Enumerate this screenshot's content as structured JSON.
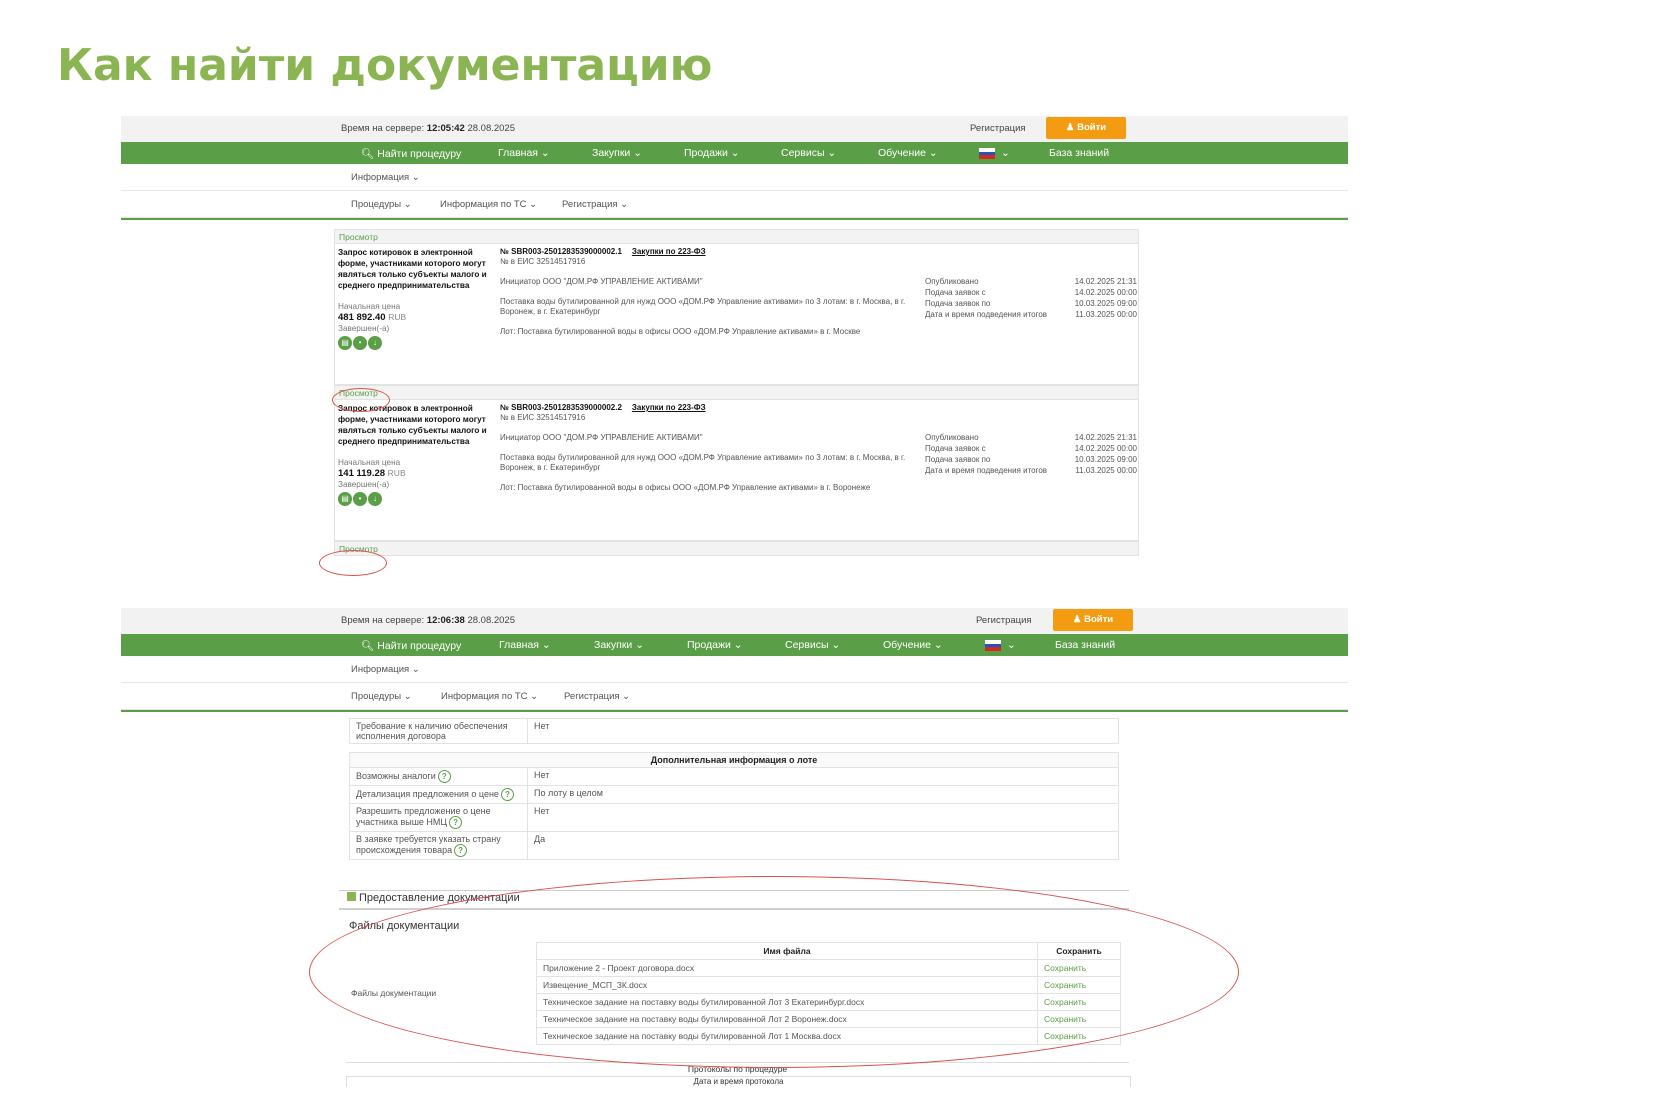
{
  "slide_title": "Как найти документацию",
  "header": {
    "time_label": "Время на сервере:",
    "registration": "Регистрация",
    "login": "Войти"
  },
  "shot1": {
    "time_bold": "12:05:42",
    "date": "28.08.2025"
  },
  "shot2": {
    "time_bold": "12:06:38",
    "date": "28.08.2025"
  },
  "nav": {
    "find": "Найти процедуру",
    "items": [
      "Главная",
      "Закупки",
      "Продажи",
      "Сервисы",
      "Обучение"
    ],
    "kb": "База знаний"
  },
  "subnav": {
    "info": "Информация",
    "procedures": "Процедуры",
    "tc_info": "Информация по ТС",
    "registration": "Регистрация"
  },
  "view_link": "Просмотр",
  "procedures": [
    {
      "title": "Запрос котировок в электронной форме, участниками которого могут являться только субъекты малого и среднего предпринимательства",
      "price_label": "Начальная цена",
      "price": "481 892.40",
      "currency": "RUB",
      "status": "Завершен(-а)",
      "number": "№ SBR003-2501283539000002.1",
      "law": "Закупки по 223-ФЗ",
      "eis": "№ в ЕИС 32514517916",
      "initiator": "Инициатор ООО \"ДОМ.РФ УПРАВЛЕНИЕ АКТИВАМИ\"",
      "subject": "Поставка воды бутилированной для нужд ООО «ДОМ.РФ Управление активами» по 3 лотам: в г. Москва, в г. Воронеж, в г. Екатеринбург",
      "lot": "Лот: Поставка бутилированной воды в офисы ООО «ДОМ.РФ Управление активами» в г. Москве",
      "dates": [
        {
          "label": "Опубликовано",
          "value": "14.02.2025 21:31"
        },
        {
          "label": "Подача заявок с",
          "value": "14.02.2025 00:00"
        },
        {
          "label": "Подача заявок по",
          "value": "10.03.2025 09:00"
        },
        {
          "label": "Дата и время подведения итогов",
          "value": "11.03.2025 00:00"
        }
      ]
    },
    {
      "title": "Запрос котировок в электронной форме, участниками которого могут являться только субъекты малого и среднего предпринимательства",
      "price_label": "Начальная цена",
      "price": "141 119.28",
      "currency": "RUB",
      "status": "Завершен(-а)",
      "number": "№ SBR003-2501283539000002.2",
      "law": "Закупки по 223-ФЗ",
      "eis": "№ в ЕИС 32514517916",
      "initiator": "Инициатор ООО \"ДОМ.РФ УПРАВЛЕНИЕ АКТИВАМИ\"",
      "subject": "Поставка воды бутилированной для нужд ООО «ДОМ.РФ Управление активами» по 3 лотам: в г. Москва, в г. Воронеж, в г. Екатеринбург",
      "lot": "Лот: Поставка бутилированной воды в офисы ООО «ДОМ.РФ Управление активами» в г. Воронеже",
      "dates": [
        {
          "label": "Опубликовано",
          "value": "14.02.2025 21:31"
        },
        {
          "label": "Подача заявок с",
          "value": "14.02.2025 00:00"
        },
        {
          "label": "Подача заявок по",
          "value": "10.03.2025 09:00"
        },
        {
          "label": "Дата и время подведения итогов",
          "value": "11.03.2025 00:00"
        }
      ]
    }
  ],
  "details": {
    "security": {
      "k": "Требование к наличию обеспечения исполнения договора",
      "v": "Нет"
    },
    "lot_info_header": "Дополнительная информация о лоте",
    "rows": [
      {
        "k": "Возможны аналоги",
        "v": "Нет"
      },
      {
        "k": "Детализация предложения о цене",
        "v": "По лоту в целом"
      },
      {
        "k": "Разрешить предложение о цене участника выше НМЦ",
        "v": "Нет"
      },
      {
        "k": "В заявке требуется указать страну происхождения товара",
        "v": "Да"
      }
    ]
  },
  "docs": {
    "section": "Предоставление документации",
    "files_title": "Файлы документации",
    "files_label": "Файлы документации",
    "col_name": "Имя файла",
    "col_save": "Сохранить",
    "save": "Сохранить",
    "files": [
      "Приложение 2 - Проект договора.docx",
      "Извещение_МСП_ЗК.docx",
      "Техническое задание на поставку воды бутилированной Лот 3 Екатеринбург.docx",
      "Техническое задание на поставку воды бутилированной Лот 2 Воронеж.docx",
      "Техническое задание на поставку воды бутилированной Лот 1 Москва.docx"
    ],
    "protocols": "Протоколы по процедуре",
    "protocol_date_col": "Дата и время протокола"
  }
}
